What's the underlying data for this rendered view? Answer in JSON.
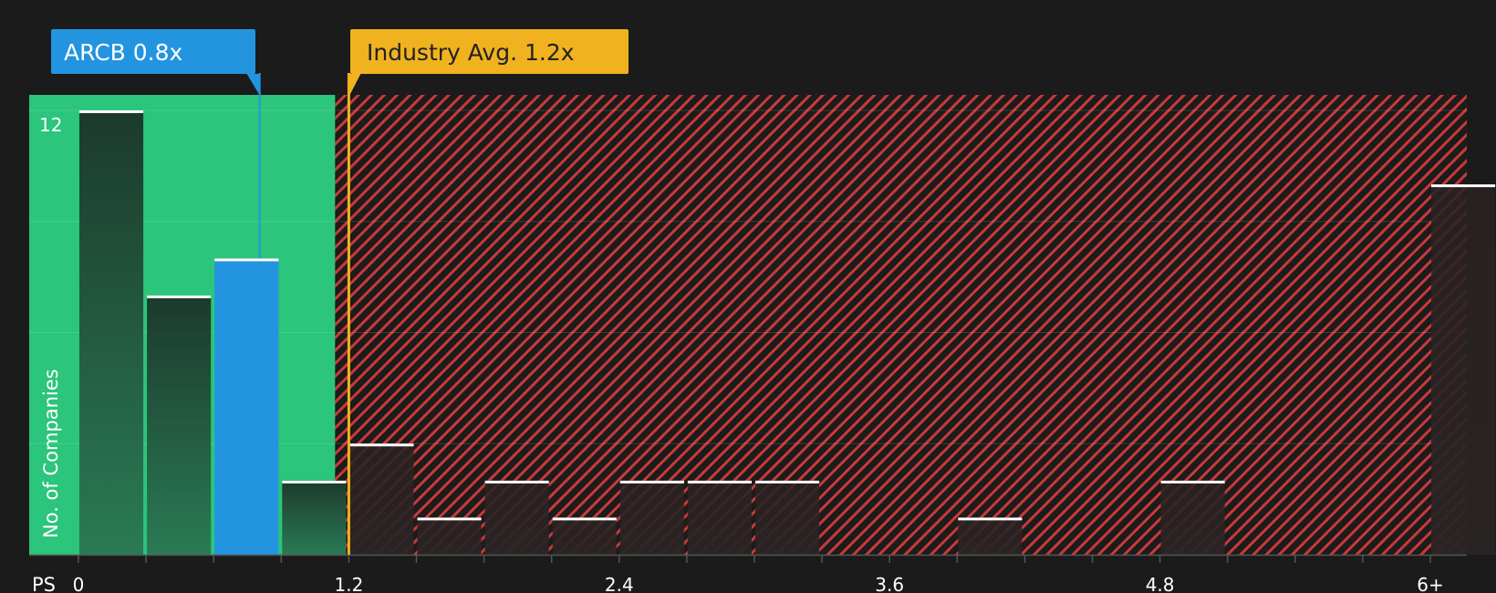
{
  "chart_data": {
    "type": "bar",
    "x_axis_label": "PS",
    "y_axis_label": "No. of Companies",
    "x_ticks": [
      {
        "value": 0,
        "label": "0"
      },
      {
        "value": 1.2,
        "label": "1.2"
      },
      {
        "value": 2.4,
        "label": "2.4"
      },
      {
        "value": 3.6,
        "label": "3.6"
      },
      {
        "value": 4.8,
        "label": "4.8"
      },
      {
        "value": 6,
        "label": "6+"
      }
    ],
    "y_ticks": [
      {
        "value": 12,
        "label": "12"
      }
    ],
    "xlim": [
      -0.2,
      6.15
    ],
    "ylim": [
      0,
      12.4
    ],
    "bin_width": 0.3,
    "bins": [
      {
        "x_start": 0.0,
        "count": 12,
        "group": "below"
      },
      {
        "x_start": 0.3,
        "count": 7,
        "group": "below"
      },
      {
        "x_start": 0.6,
        "count": 8,
        "group": "company"
      },
      {
        "x_start": 0.9,
        "count": 2,
        "group": "below"
      },
      {
        "x_start": 1.2,
        "count": 3,
        "group": "above"
      },
      {
        "x_start": 1.5,
        "count": 1,
        "group": "above"
      },
      {
        "x_start": 1.8,
        "count": 2,
        "group": "above"
      },
      {
        "x_start": 2.1,
        "count": 1,
        "group": "above"
      },
      {
        "x_start": 2.4,
        "count": 2,
        "group": "above"
      },
      {
        "x_start": 2.7,
        "count": 2,
        "group": "above"
      },
      {
        "x_start": 3.0,
        "count": 2,
        "group": "above"
      },
      {
        "x_start": 3.9,
        "count": 1,
        "group": "above"
      },
      {
        "x_start": 4.8,
        "count": 2,
        "group": "above"
      },
      {
        "x_start": 6.0,
        "count": 10,
        "group": "above"
      }
    ],
    "company": {
      "ticker": "ARCB",
      "value": 0.8,
      "label": "ARCB 0.8x"
    },
    "industry_avg": {
      "value": 1.2,
      "label": "Industry Avg. 1.2x"
    },
    "grid": true,
    "colors": {
      "background": "#1b1b1b",
      "undervalued_zone": "#2bc57c",
      "overvalued_hatch": "#c93a3a",
      "company": "#2394e0",
      "industry": "#f0b21f",
      "bar_dark": "#1f3a2c",
      "cap": "#ffffff"
    }
  }
}
